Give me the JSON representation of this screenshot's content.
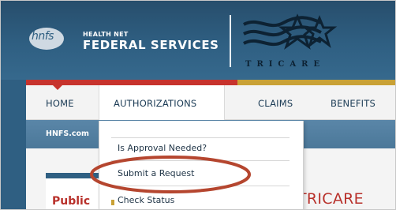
{
  "header": {
    "logo_mark": "hnfs",
    "brand_line1": "HEALTH NET",
    "brand_line2": "FEDERAL SERVICES",
    "partner_logo_word": "TRICARE",
    "partner_logo_trademark": "®"
  },
  "nav": {
    "items": [
      {
        "label": "HOME"
      },
      {
        "label": "AUTHORIZATIONS"
      },
      {
        "label": "CLAIMS"
      },
      {
        "label": "BENEFITS"
      }
    ],
    "active": "AUTHORIZATIONS"
  },
  "breadcrumb": "HNFS.com",
  "dropdown": {
    "items": [
      {
        "label": "Is Approval Needed?"
      },
      {
        "label": "Submit a Request"
      },
      {
        "label": "Check Status"
      }
    ],
    "highlighted": "Submit a Request"
  },
  "content": {
    "left_panel_title": "Public",
    "main_heading": "TRICARE"
  },
  "colors": {
    "header_blue": "#2f5f82",
    "accent_red": "#c7332d",
    "accent_gold": "#c9a136",
    "highlight_ring": "#b5462f"
  }
}
